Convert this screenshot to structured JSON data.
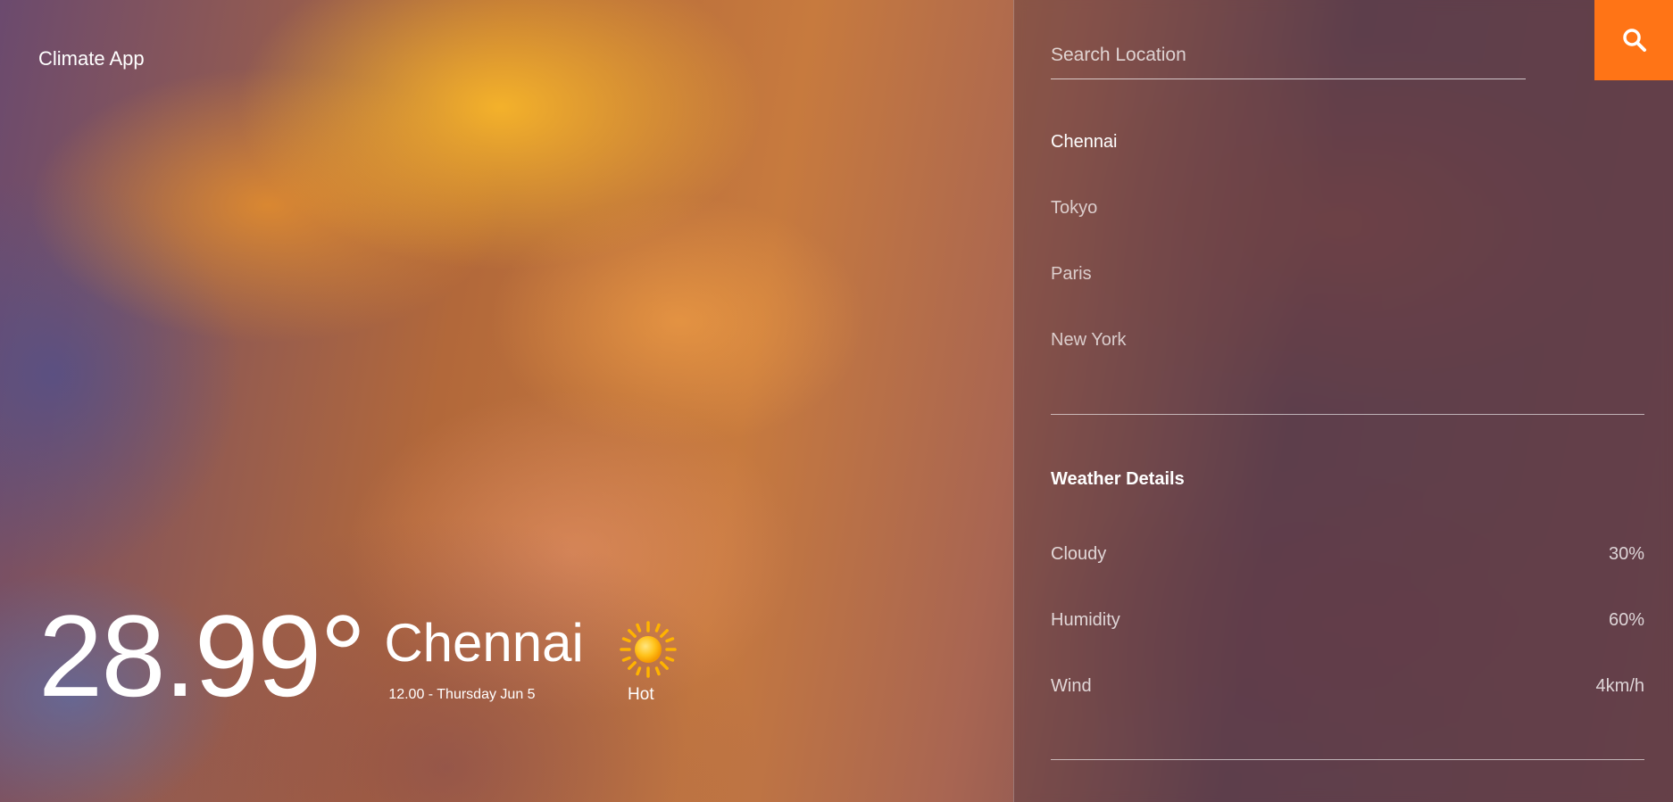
{
  "brand": {
    "title": "Climate App"
  },
  "current": {
    "temperature": "28.99°",
    "city": "Chennai",
    "datetime": "12.00 -  Thursday Jun 5",
    "condition": "Hot",
    "condition_icon": "sun-icon"
  },
  "search": {
    "placeholder": "Search Location",
    "value": "",
    "button_icon": "search-icon",
    "button_color": "#ff7416"
  },
  "locations": {
    "items": [
      {
        "label": "Chennai",
        "active": true
      },
      {
        "label": "Tokyo",
        "active": false
      },
      {
        "label": "Paris",
        "active": false
      },
      {
        "label": "New York",
        "active": false
      }
    ]
  },
  "details": {
    "title": "Weather Details",
    "rows": [
      {
        "label": "Cloudy",
        "value": "30%"
      },
      {
        "label": "Humidity",
        "value": "60%"
      },
      {
        "label": "Wind",
        "value": "4km/h"
      }
    ]
  }
}
